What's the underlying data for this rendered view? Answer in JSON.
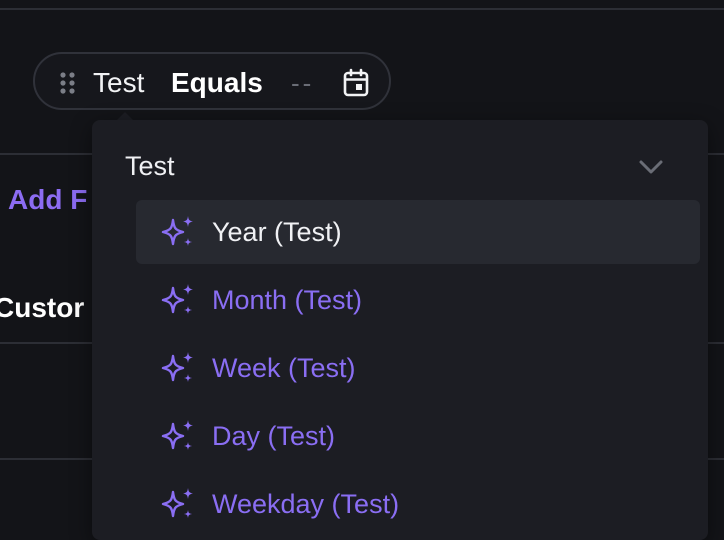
{
  "filter": {
    "field": "Test",
    "operator": "Equals",
    "value": "--"
  },
  "background": {
    "link_partial": "Add F",
    "label_partial": "Custor"
  },
  "dropdown": {
    "group_title": "Test",
    "options": [
      {
        "label": "Year (Test)",
        "icon": "sparkles-icon",
        "highlighted": true
      },
      {
        "label": "Month (Test)",
        "icon": "sparkles-icon"
      },
      {
        "label": "Week (Test)",
        "icon": "sparkles-icon"
      },
      {
        "label": "Day (Test)",
        "icon": "sparkles-icon"
      },
      {
        "label": "Weekday (Test)",
        "icon": "sparkles-icon"
      }
    ]
  },
  "colors": {
    "background": "#131418",
    "panel": "#1c1d23",
    "accent": "#8a6ef3",
    "highlight": "#272930",
    "muted": "#6a6d76"
  }
}
